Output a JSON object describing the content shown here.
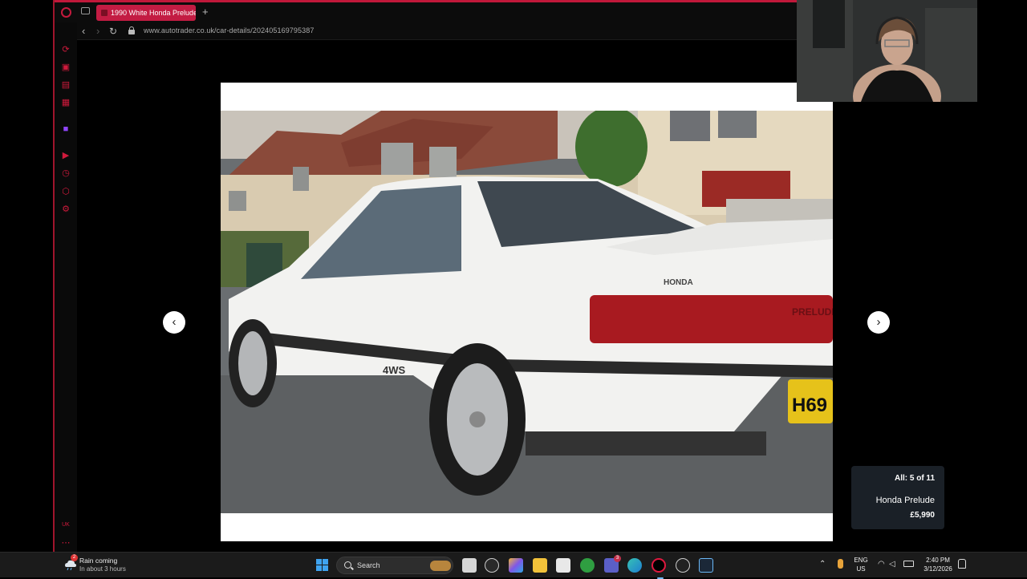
{
  "browser": {
    "tab_title": "1990 White Honda Prelude",
    "url": "www.autotrader.co.uk/car-details/202405169795387",
    "sidebar_icons": [
      "loop-icon",
      "bag-icon",
      "chat-icon",
      "messenger-icon",
      "twitch-icon",
      "player-icon",
      "history-icon",
      "extensions-icon",
      "settings-icon"
    ],
    "sidebar_bottom": [
      "uk-icon",
      "more-icon"
    ]
  },
  "viewer": {
    "counter": "All: 5 of 11",
    "title": "Honda Prelude",
    "price": "£5,990",
    "prev_label": "‹",
    "next_label": "›",
    "photo_alt": "White Honda Prelude 4WS parked on a residential street",
    "badge_text": "4WS",
    "brand_text": "HONDA",
    "model_text": "PRELUDE",
    "plate_text": "H69"
  },
  "taskbar": {
    "weather_title": "Rain coming",
    "weather_sub": "In about 3 hours",
    "weather_badge": "2",
    "search_label": "Search",
    "language_top": "ENG",
    "language_bottom": "US",
    "time": "2:40 PM",
    "date": "3/12/2026",
    "teams_badge": "3"
  },
  "colors": {
    "accent": "#c31c43",
    "card_bg": "#1a2027",
    "taskbar_bg": "#1b1b1b"
  }
}
